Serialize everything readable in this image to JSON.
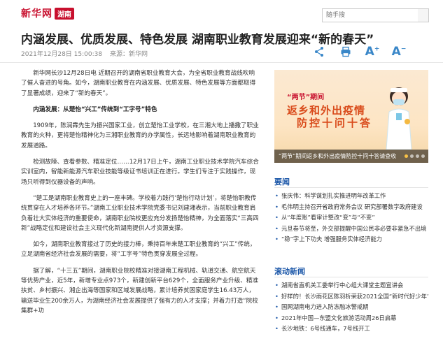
{
  "brand": {
    "logo": "新华网",
    "region": "湖南"
  },
  "search": {
    "placeholder": "随手搜"
  },
  "article": {
    "title": "内涵发展、优质发展、特色发展 湖南职业教育发展迎来“新的春天”",
    "datetime": "2021年12月28日 15:00:38",
    "source": "来源：新华网",
    "paragraphs": [
      {
        "type": "text",
        "text": "新华网长沙12月28日电 近期召开的湖南省职业教育大会，为全省职业教育战线吹响了催人奋进的号角。如今，湖南职业教育在内涵发展、优质发展、特色发展等方面都取得了显著成绩，迎来了“新的春天”。"
      },
      {
        "type": "sub",
        "text": "内涵发展：从楚怡“兴工”传统到“工字号”特色"
      },
      {
        "type": "text",
        "text": "1909年，陈润霖先生为振兴国家工业，创立楚怡工业学校，在三湘大地上播撒了职业教育的火种，更将楚怡精神化为三湘职业教育的办学属性，长远地影响着湖南职业教育的发展道路。"
      },
      {
        "type": "text",
        "text": "检测故障、查看参数、精准定位……12月17日上午，湖南工业职业技术学院汽车综合实训室内，智能新能源汽车职业技能等级证书培训正在进行。学生们专注于实践操作，现场只听得到仪器设备的声响。"
      },
      {
        "type": "text",
        "text": "“楚工是湖南职业教育史上的一座丰碑。学校着力践行‘楚怡行动计划’，将楚怡职教传统贯穿在人才培养各环节。”湖南工业职业技术学院党委书记刘建湘表示，当前职业教育肩负着壮大实体经济的重要使命，湖南职业院校更应充分发扬楚怡精神，为全面落实“三高四新”战略定位和建设社会主义现代化新湖南提供人才资源支撑。"
      },
      {
        "type": "text",
        "text": "如今，湖南职业教育接过了历史的接力棒，秉持百年来楚工职业教育的“兴工”传统，立足湖南省经济社会发展的需要，将“工字号”特色贯穿发展全过程。"
      },
      {
        "type": "text",
        "text": "据了解，“十三五”期间，湖南职业院校精准对接湖南工程机械、轨道交通、航空航天等优势产业，近5年，新增专业点973个，新建创新平台629个，全面服务产业升级、精准扶贫、乡村振兴、湘企出海等国家和区域发展战略，累计培养贫困家庭学生16.43万人，输送毕业生200余万人，为湖南经济社会发展提供了强有力的人才支撑；并着力打造“院校集群+功"
      }
    ]
  },
  "banner": {
    "tag": "“两节”期间",
    "line1": "返乡和外出疫情",
    "line2": "防控十问十答",
    "caption": "“两节”期间返乡和外出疫情防控十问十答请查收"
  },
  "sections": [
    {
      "title": "要闻",
      "items": [
        "张庆伟：科学谋划扎实推进明年改革工作",
        "毛伟明主持召开省政府常务会议 研究部署数字政府建设",
        "从“年度账”看审计整改“变”与“不变”",
        "元旦春节将至，外交部提醒中国公民非必要非紧急不出境",
        "“稳”字上下功夫 增强服务实体经济能力"
      ]
    },
    {
      "title": "滚动新闻",
      "items": [
        "湖南省直机关工委举行中心组大课堂主题宣讲会",
        "好样的！长沙雨花区陈羽析荣获2021全国“新时代好少年”",
        "国网湖南电力进入防冻融冰警戒期",
        "2021年中国—东盟文化旅游活动周26日启幕",
        "长沙地铁：6号线通车，7号线开工"
      ]
    }
  ],
  "colors": {
    "brand": "#c8102e",
    "accent": "#3a87c8",
    "section": "#1a56a8"
  }
}
